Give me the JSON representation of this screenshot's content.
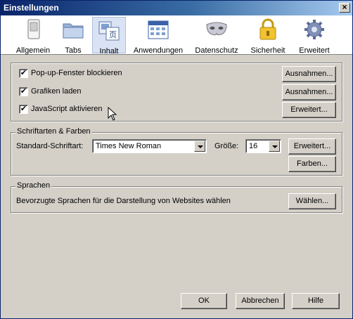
{
  "window": {
    "title": "Einstellungen",
    "close_glyph": "×"
  },
  "tabs": [
    {
      "label": "Allgemein",
      "icon": "switch-icon",
      "active": false
    },
    {
      "label": "Tabs",
      "icon": "folder-icon",
      "active": false
    },
    {
      "label": "Inhalt",
      "icon": "content-icon",
      "active": true
    },
    {
      "label": "Anwendungen",
      "icon": "calendar-icon",
      "active": false
    },
    {
      "label": "Datenschutz",
      "icon": "mask-icon",
      "active": false
    },
    {
      "label": "Sicherheit",
      "icon": "lock-icon",
      "active": false
    },
    {
      "label": "Erweitert",
      "icon": "gear-icon",
      "active": false
    }
  ],
  "content": {
    "popup_label": "Pop-up-Fenster blockieren",
    "popup_checked": true,
    "popup_button": "Ausnahmen...",
    "images_label": "Grafiken laden",
    "images_checked": true,
    "images_button": "Ausnahmen...",
    "js_label": "JavaScript aktivieren",
    "js_checked": true,
    "js_button": "Erweitert..."
  },
  "fonts": {
    "legend": "Schriftarten & Farben",
    "default_font_label": "Standard-Schriftart:",
    "default_font_value": "Times New Roman",
    "size_label": "Größe:",
    "size_value": "16",
    "advanced_button": "Erweitert...",
    "colors_button": "Farben..."
  },
  "languages": {
    "legend": "Sprachen",
    "description": "Bevorzugte Sprachen für die Darstellung von Websites wählen",
    "choose_button": "Wählen..."
  },
  "footer": {
    "ok": "OK",
    "cancel": "Abbrechen",
    "help": "Hilfe"
  },
  "check_glyph": "✔"
}
